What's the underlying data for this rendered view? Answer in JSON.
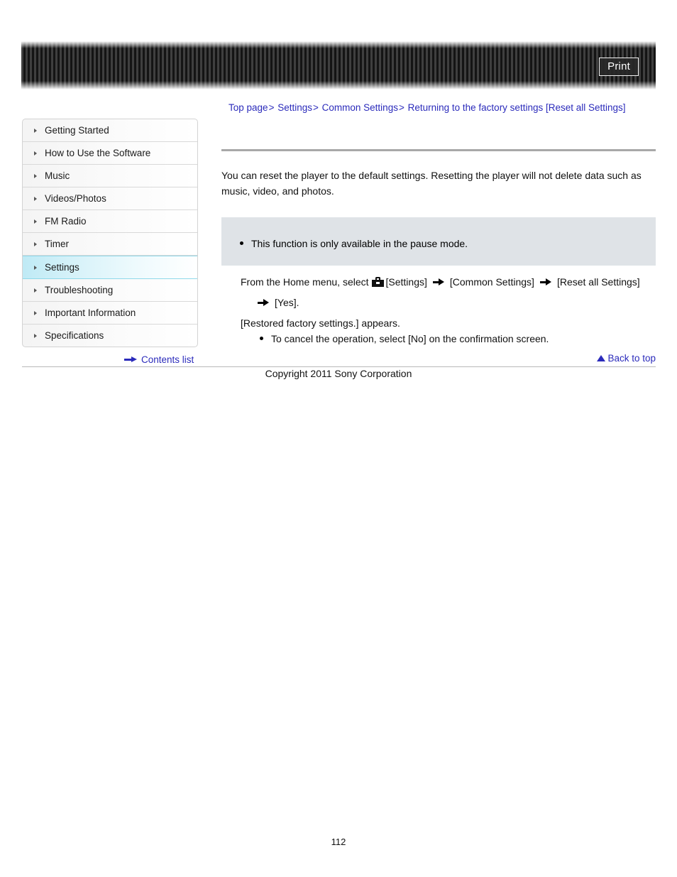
{
  "header": {
    "print_label": "Print"
  },
  "breadcrumb": {
    "separator": ">",
    "items": [
      {
        "label": "Top page"
      },
      {
        "label": "Settings"
      },
      {
        "label": "Common Settings"
      },
      {
        "label": "Returning to the factory settings [Reset all Settings]"
      }
    ]
  },
  "sidebar": {
    "items": [
      {
        "label": "Getting Started",
        "active": false
      },
      {
        "label": "How to Use the Software",
        "active": false
      },
      {
        "label": "Music",
        "active": false
      },
      {
        "label": "Videos/Photos",
        "active": false
      },
      {
        "label": "FM Radio",
        "active": false
      },
      {
        "label": "Timer",
        "active": false
      },
      {
        "label": "Settings",
        "active": true
      },
      {
        "label": "Troubleshooting",
        "active": false
      },
      {
        "label": "Important Information",
        "active": false
      },
      {
        "label": "Specifications",
        "active": false
      }
    ],
    "contents_list_label": "Contents list"
  },
  "main": {
    "intro": "You can reset the player to the default settings. Resetting the player will not delete data such as music, video, and photos.",
    "note": "This function is only available in the pause mode.",
    "step_prefix": "From the Home menu, select",
    "step_settings": "[Settings]",
    "step_common_settings": "[Common Settings]",
    "step_reset_all": "[Reset all Settings]",
    "step_yes": "[Yes].",
    "result_text": "[Restored factory settings.] appears.",
    "cancel_text": "To cancel the operation, select [No] on the confirmation screen.",
    "back_to_top_label": "Back to top"
  },
  "footer": {
    "copyright": "Copyright 2011 Sony Corporation",
    "page_number": "112"
  },
  "colors": {
    "link": "#2b2bbb",
    "note_bg": "#dfe3e7",
    "active_nav": "#bfeaf5"
  }
}
